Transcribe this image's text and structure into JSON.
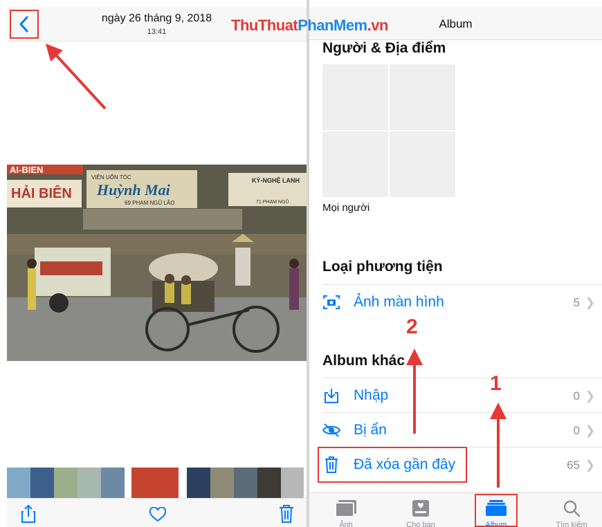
{
  "left": {
    "date": "ngày 26 tháng 9, 2018",
    "time": "13:41"
  },
  "watermark": {
    "part1": "ThuThuat",
    "part2": "PhanMem",
    "part3": ".vn"
  },
  "right": {
    "title": "Album",
    "sections": {
      "people_places": "Người & Địa điểm",
      "people_label": "Mọi người",
      "media_types": "Loại phương tiện",
      "other_albums": "Album khác"
    },
    "rows": {
      "screenshots": {
        "label": "Ảnh màn hình",
        "count": "5"
      },
      "import": {
        "label": "Nhập",
        "count": "0"
      },
      "hidden": {
        "label": "Bị ẩn",
        "count": "0"
      },
      "deleted": {
        "label": "Đã xóa gần đây",
        "count": "65"
      }
    },
    "tabs": [
      {
        "label": "Ảnh"
      },
      {
        "label": "Cho bạn"
      },
      {
        "label": "Album"
      },
      {
        "label": "Tìm kiếm"
      }
    ]
  },
  "photo_signs": {
    "sign1": "AI-BIEN",
    "sign2": "HẢI BIÊN",
    "sign3": "VIÊN UỐN TÓC",
    "sign4": "Huỳnh Mai",
    "sign5": "KỲ-NGHỆ LANH",
    "sign6": "69 PHẠM NGŨ LÃO",
    "sign7": "71 PHẠM NGŨ"
  },
  "steps": {
    "one": "1",
    "two": "2"
  },
  "colors": {
    "accent": "#007aff",
    "annotation": "#e53935"
  }
}
